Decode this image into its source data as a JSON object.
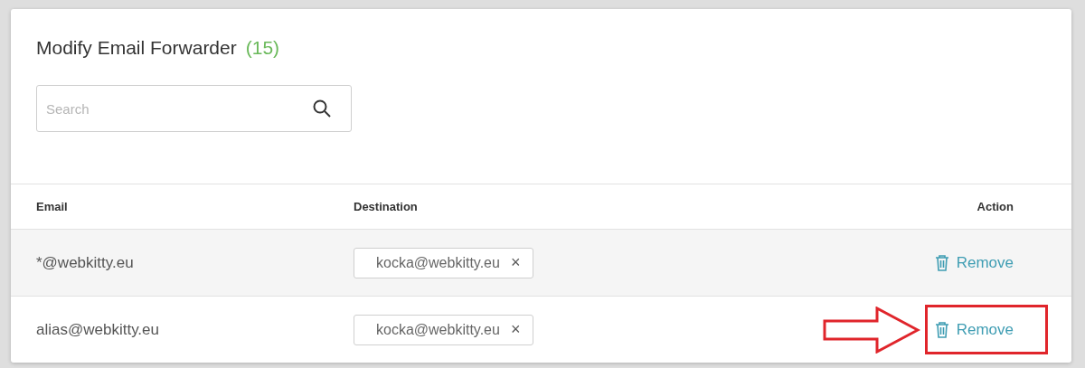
{
  "title": "Modify Email Forwarder",
  "count": "(15)",
  "search": {
    "placeholder": "Search"
  },
  "table": {
    "columns": [
      "Email",
      "Destination",
      "Action"
    ],
    "rows": [
      {
        "email": "*@webkitty.eu",
        "destinations": [
          "kocka@webkitty.eu"
        ],
        "remove_icon": "×",
        "action": "Remove",
        "annotated": false
      },
      {
        "email": "alias@webkitty.eu",
        "destinations": [
          "kocka@webkitty.eu"
        ],
        "remove_icon": "×",
        "action": "Remove",
        "annotated": true
      }
    ]
  }
}
